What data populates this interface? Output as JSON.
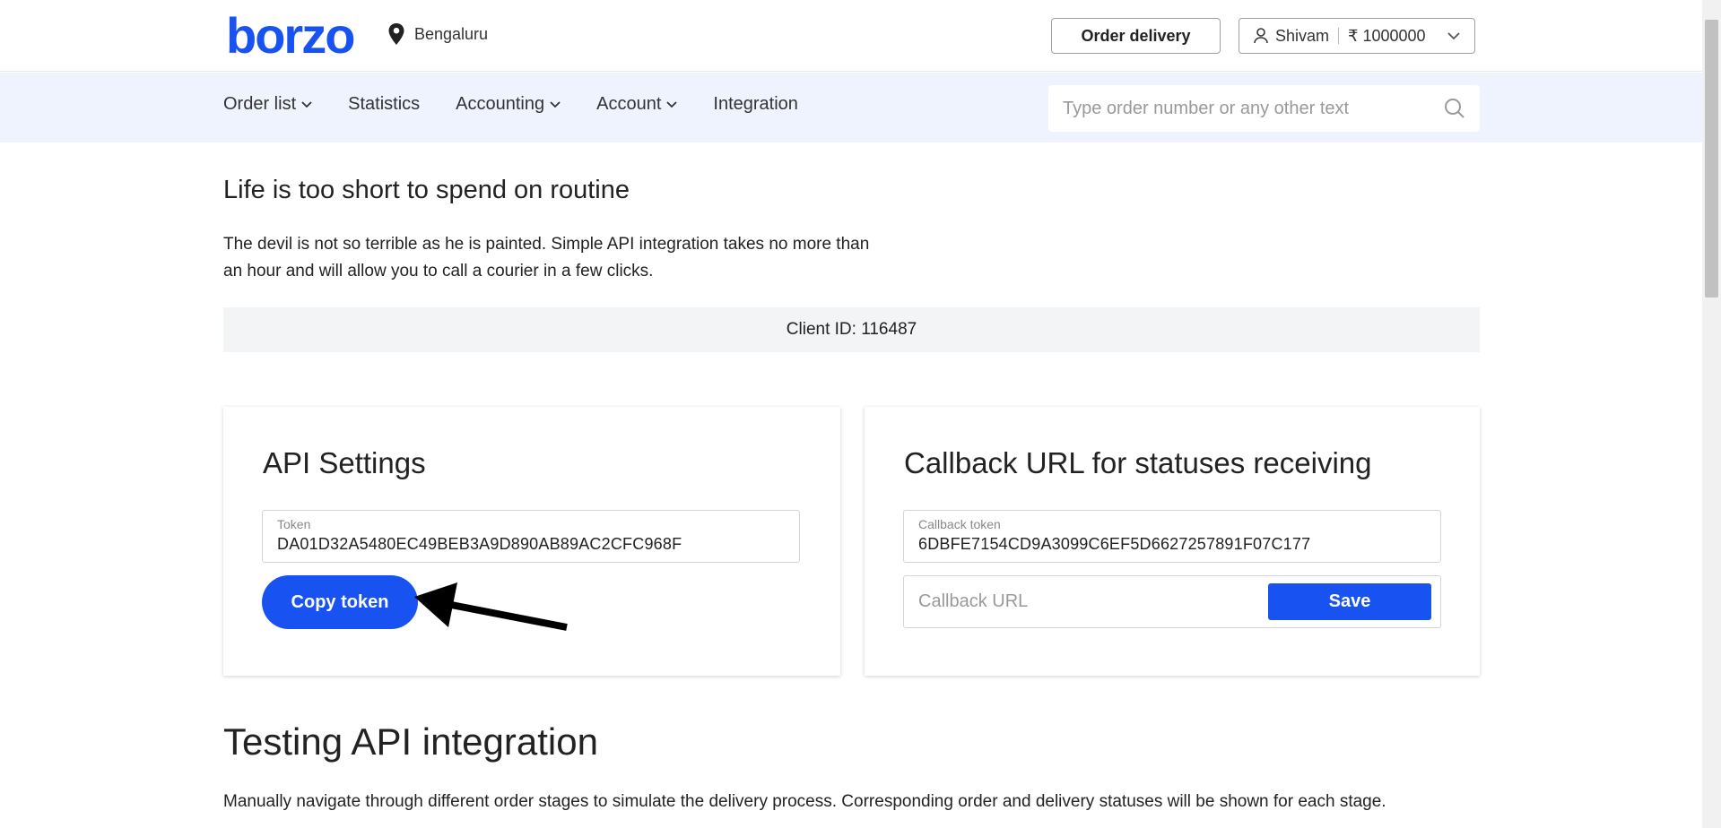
{
  "header": {
    "logo": "borzo",
    "city": "Bengaluru",
    "order_button": "Order delivery",
    "user_name": "Shivam",
    "balance": "₹ 1000000"
  },
  "nav": {
    "items": [
      {
        "label": "Order list",
        "dropdown": true
      },
      {
        "label": "Statistics",
        "dropdown": false
      },
      {
        "label": "Accounting",
        "dropdown": true
      },
      {
        "label": "Account",
        "dropdown": true
      },
      {
        "label": "Integration",
        "dropdown": false
      }
    ],
    "search_placeholder": "Type order number or any other text"
  },
  "main": {
    "heading": "Life is too short to spend on routine",
    "intro": "The devil is not so terrible as he is painted. Simple API integration takes no more than an hour and will allow you to call a courier in a few clicks.",
    "client_id": "Client ID: 116487"
  },
  "api_settings": {
    "title": "API Settings",
    "token_label": "Token",
    "token_value": "DA01D32A5480EC49BEB3A9D890AB89AC2CFC968F",
    "copy_button": "Copy token"
  },
  "callback": {
    "title": "Callback URL for statuses receiving",
    "token_label": "Callback token",
    "token_value": "6DBFE7154CD9A3099C6EF5D6627257891F07C177",
    "url_placeholder": "Callback URL",
    "save_button": "Save"
  },
  "testing": {
    "heading": "Testing API integration",
    "description": "Manually navigate through different order stages to simulate the delivery process. Corresponding order and delivery statuses will be shown for each stage."
  },
  "colors": {
    "brand": "#1853f2",
    "nav_bg": "#eef3fd"
  }
}
